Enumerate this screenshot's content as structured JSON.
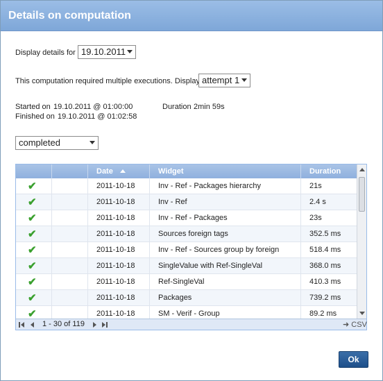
{
  "dialog": {
    "title": "Details on computation"
  },
  "display_details": {
    "label": "Display details for",
    "value": "19.10.2011"
  },
  "multi": {
    "text": "This computation required multiple executions. Display",
    "value": "attempt 1"
  },
  "timing": {
    "started_label": "Started on",
    "started_value": "19.10.2011 @ 01:00:00",
    "finished_label": "Finished on",
    "finished_value": "19.10.2011 @ 01:02:58",
    "duration_label": "Duration",
    "duration_value": "2min 59s"
  },
  "status_filter": {
    "value": "completed"
  },
  "grid": {
    "columns": [
      "",
      "",
      "Date",
      "Widget",
      "Duration"
    ],
    "rows": [
      {
        "status": "✔",
        "date": "2011-10-18",
        "widget": "Inv - Ref - Packages hierarchy",
        "duration": "21s"
      },
      {
        "status": "✔",
        "date": "2011-10-18",
        "widget": "Inv - Ref",
        "duration": "2.4 s"
      },
      {
        "status": "✔",
        "date": "2011-10-18",
        "widget": "Inv - Ref - Packages",
        "duration": "23s"
      },
      {
        "status": "✔",
        "date": "2011-10-18",
        "widget": "Sources foreign tags",
        "duration": "352.5 ms"
      },
      {
        "status": "✔",
        "date": "2011-10-18",
        "widget": "Inv - Ref - Sources group by foreign",
        "duration": "518.4 ms"
      },
      {
        "status": "✔",
        "date": "2011-10-18",
        "widget": "SingleValue with Ref-SingleVal",
        "duration": "368.0 ms"
      },
      {
        "status": "✔",
        "date": "2011-10-18",
        "widget": "Ref-SingleVal",
        "duration": "410.3 ms"
      },
      {
        "status": "✔",
        "date": "2011-10-18",
        "widget": "Packages",
        "duration": "739.2 ms"
      },
      {
        "status": "✔",
        "date": "2011-10-18",
        "widget": "SM - Verif - Group",
        "duration": "89.2 ms"
      }
    ],
    "pager": {
      "range": "1 - 30 of 119",
      "export": "CSV"
    }
  },
  "buttons": {
    "ok": "Ok"
  },
  "colors": {
    "title_bar": "#86addc",
    "header": "#99b9e2",
    "check": "#3aa02e",
    "ok_button": "#2a5d98"
  }
}
